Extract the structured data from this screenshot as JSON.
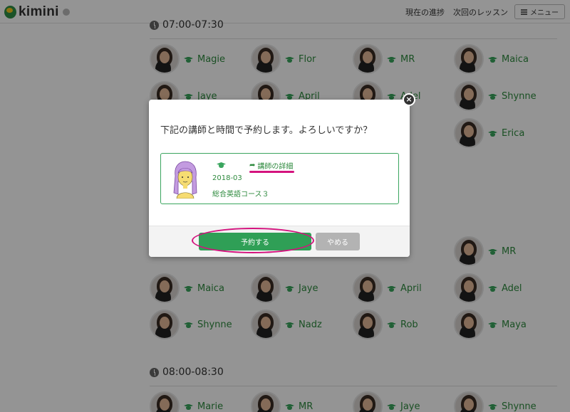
{
  "header": {
    "logo_text": "kimini",
    "nav_progress": "現在の進捗",
    "nav_next_lesson": "次回のレッスン",
    "menu_label": "メニュー"
  },
  "slots": [
    {
      "time": "07:00-07:30",
      "tutors": [
        "Magie",
        "Flor",
        "MR",
        "Maica",
        "Jaye",
        "April",
        "Adel",
        "Shynne",
        "",
        "",
        "",
        "Erica"
      ]
    },
    {
      "time": "",
      "tutors": [
        "",
        "",
        "",
        "MR",
        "Maica",
        "Jaye",
        "April",
        "Adel",
        "Shynne",
        "Nadz",
        "Rob",
        "Maya"
      ]
    },
    {
      "time": "08:00-08:30",
      "tutors": [
        "Marie",
        "MR",
        "Jaye",
        "Shynne"
      ]
    }
  ],
  "modal": {
    "message": "下記の講師と時間で予約します。よろしいですか？",
    "detail_link": "講師の詳細",
    "date": "2018-03",
    "course": "総合英語コース３",
    "reserve_button": "予約する",
    "cancel_button": "やめる",
    "close_symbol": "×"
  },
  "colors": {
    "accent_green": "#2f9f56",
    "annotation_magenta": "#d4137e"
  }
}
